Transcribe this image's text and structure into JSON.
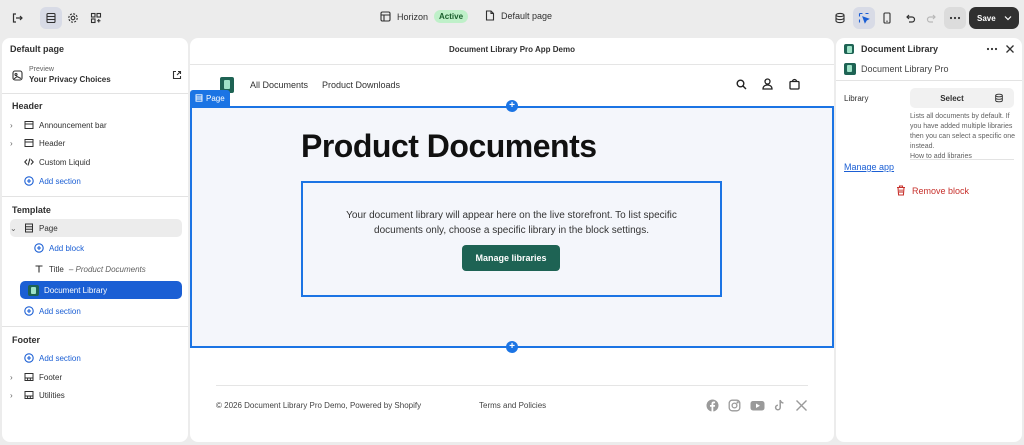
{
  "topbar": {
    "theme_name": "Horizon",
    "theme_status": "Active",
    "page_selector": "Default page",
    "save_label": "Save",
    "icons": [
      "exit-icon",
      "sections-icon",
      "settings-icon",
      "apps-icon",
      "database-icon",
      "inspector-icon",
      "mobile-icon",
      "undo-icon",
      "redo-icon",
      "more-icon",
      "chevron-down-icon"
    ]
  },
  "left_panel": {
    "title": "Default page",
    "preview": {
      "small": "Preview",
      "main": "Your Privacy Choices"
    },
    "header_section": {
      "heading": "Header",
      "items": [
        {
          "label": "Announcement bar"
        },
        {
          "label": "Header"
        },
        {
          "label": "Custom Liquid"
        }
      ],
      "add_label": "Add section"
    },
    "template_section": {
      "heading": "Template",
      "page_label": "Page",
      "add_block_label": "Add block",
      "title_label": "Title",
      "title_sub": "– Product Documents",
      "doc_library_label": "Document Library",
      "add_label": "Add section"
    },
    "footer_section": {
      "heading": "Footer",
      "add_label": "Add section",
      "items": [
        {
          "label": "Footer"
        },
        {
          "label": "Utilities"
        }
      ]
    }
  },
  "canvas": {
    "store_title": "Document Library Pro App Demo",
    "nav": [
      "All Documents",
      "Product Downloads"
    ],
    "page_tag": "Page",
    "heading": "Product Documents",
    "message": "Your document library will appear here on the live storefront. To list specific documents only, choose a specific library in the block settings.",
    "manage_button": "Manage libraries",
    "footer_copyright": "© 2026 Document Library Pro Demo, Powered by Shopify",
    "footer_policies": "Terms and Policies",
    "social_icons": [
      "facebook-icon",
      "instagram-icon",
      "youtube-icon",
      "tiktok-icon",
      "x-icon"
    ]
  },
  "right_panel": {
    "title": "Document Library",
    "app_name": "Document Library Pro",
    "library_label": "Library",
    "select_label": "Select",
    "help_text": "Lists all documents by default. If you have added multiple libraries then you can select a specific one instead.",
    "help_link": "How to add libraries",
    "manage_app": "Manage app",
    "remove_block": "Remove block"
  },
  "colors": {
    "accent": "#1b74e4",
    "selected": "#1b5fd4",
    "brand_button": "#1e6354",
    "danger": "#c7302b",
    "active_badge": "#bff0c9"
  }
}
